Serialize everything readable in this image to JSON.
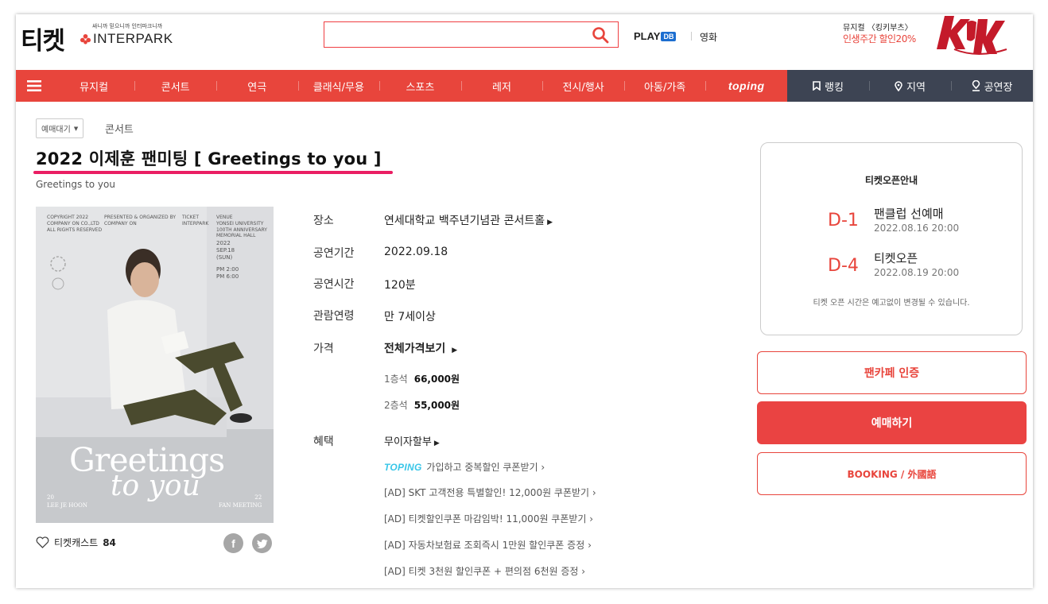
{
  "header": {
    "logo_main": "티켓",
    "logo_tagline": "싸니까 믿으니까 인터파크니까",
    "logo_brand": "INTERPARK",
    "search_placeholder": "",
    "playdb_text": "PLAY",
    "playdb_box": "DB",
    "movie_label": "영화",
    "promo_line1": "뮤지컬 〈킹키부츠〉",
    "promo_line2": "인생주간 할인20%"
  },
  "nav": {
    "items": [
      "뮤지컬",
      "콘서트",
      "연극",
      "클래식/무용",
      "스포츠",
      "레저",
      "전시/행사",
      "아동/가족",
      "toping"
    ],
    "dark_items": [
      "랭킹",
      "지역",
      "공연장"
    ]
  },
  "breadcrumb": {
    "status_select": "예매대기",
    "category": "콘서트"
  },
  "product": {
    "title": "2022 이제훈 팬미팅 [ Greetings to you ]",
    "subtitle": "Greetings to you"
  },
  "poster": {
    "big_text": "Greetings",
    "italic_text": "to you",
    "top_left": "COPYRIGHT 2022\nCOMPANY ON CO.,LTD\nALL RIGHTS RESERVED",
    "top_mid": "PRESENTED & ORGANIZED BY\nCOMPANY ON",
    "top_ticket": "TICKET\nINTERPARK",
    "top_venue": "VENUE\nYONSEI UNIVERSITY\n100TH ANNIVERSARY\nMEMORIAL HALL",
    "date_block": "2022\nSEP.18\n(SUN)",
    "time_block": "PM 2:00\nPM 6:00",
    "foot_left": "20\nLEE JE HOON",
    "foot_right": "22\nFAN MEETING"
  },
  "cast": {
    "label": "티켓캐스트",
    "count": "84"
  },
  "info": {
    "venue_label": "장소",
    "venue_value": "연세대학교 백주년기념관 콘서트홀",
    "period_label": "공연기간",
    "period_value": "2022.09.18",
    "runtime_label": "공연시간",
    "runtime_value": "120분",
    "age_label": "관람연령",
    "age_value": "만 7세이상",
    "price_label": "가격",
    "price_link": "전체가격보기",
    "seats": [
      {
        "name": "1층석",
        "price": "66,000원"
      },
      {
        "name": "2층석",
        "price": "55,000원"
      }
    ],
    "benefit_label": "혜택",
    "benefit_main": "무이자할부",
    "toping_tag": "TOPING",
    "benefits": [
      "가입하고 중복할인 쿠폰받기",
      "[AD] SKT 고객전용 특별할인! 12,000원 쿠폰받기",
      "[AD] 티켓할인쿠폰 마감임박! 11,000원 쿠폰받기",
      "[AD] 자동차보험료 조회즉시 1만원 할인쿠폰 증정",
      "[AD] 티켓 3천원 할인쿠폰 + 편의점 6천원 증정"
    ]
  },
  "ticket_open": {
    "title": "티켓오픈안내",
    "entries": [
      {
        "dday": "D-1",
        "name": "팬클럽 선예매",
        "date": "2022.08.16 20:00"
      },
      {
        "dday": "D-4",
        "name": "티켓오픈",
        "date": "2022.08.19 20:00"
      }
    ],
    "note": "티켓 오픈 시간은 예고없이 변경될 수 있습니다."
  },
  "actions": {
    "fancafe": "팬카페 인증",
    "reserve": "예매하기",
    "booking": "BOOKING / 外國語"
  },
  "colors": {
    "accent": "#e8453c",
    "nav_dark": "#3d4453",
    "title_underline": "#ea1e63",
    "toping": "#38c6e8"
  }
}
